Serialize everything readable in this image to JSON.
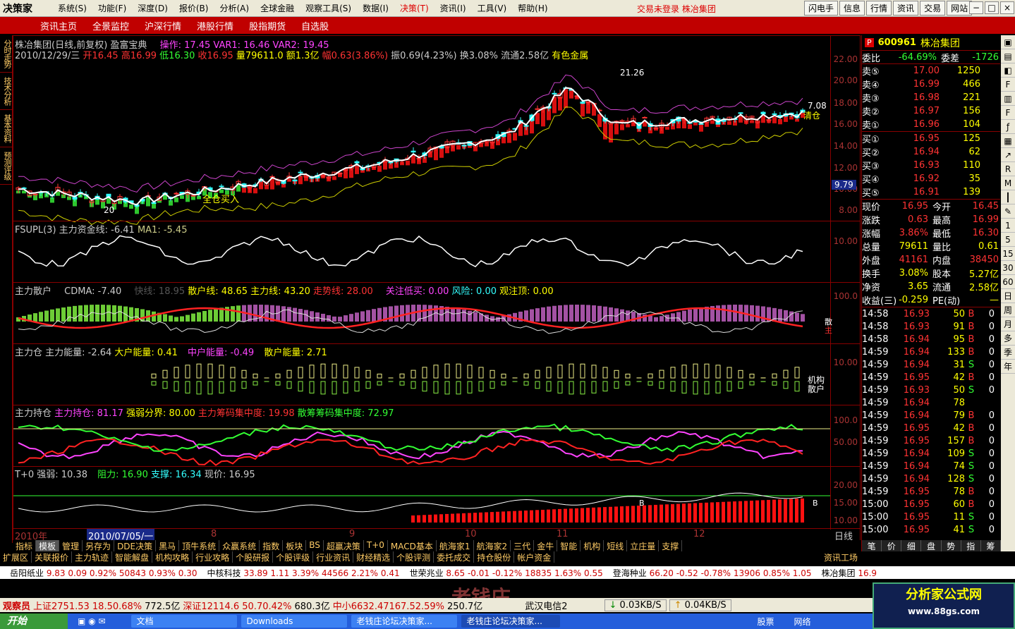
{
  "menubar": {
    "logo": "决策家",
    "items": [
      "系统(S)",
      "功能(F)",
      "深度(D)",
      "报价(B)",
      "分析(A)",
      "全球金融",
      "观察工具(S)",
      "数据(I)",
      "决策(T)",
      "资讯(I)",
      "工具(V)",
      "帮助(H)"
    ],
    "active_item": "决策(T)",
    "status_text": "交易未登录  株冶集团",
    "quick_buttons": [
      "闪电手",
      "信息",
      "行情",
      "资讯",
      "交易",
      "网站"
    ],
    "window_controls": [
      "−",
      "□",
      "×"
    ]
  },
  "navbar": {
    "tabs": [
      "资讯主页",
      "全景监控",
      "沪深行情",
      "港股行情",
      "股指期货",
      "自选股"
    ]
  },
  "leftstrip": [
    "分时走势",
    "技术分析",
    "基本资料",
    "预测评级"
  ],
  "chart": {
    "header1": "株冶集团(日线,前复权) 盈富宝典",
    "header1_ops": "操作: 17.45 VAR1: 16.46 VAR2: 19.45",
    "header2_date": "2010/12/29/三",
    "header2_open": "开16.45",
    "header2_high": "高16.99",
    "header2_low": "低16.30",
    "header2_close": "收16.95",
    "header2_vol": "量79611.0",
    "header2_amt": "额1.3亿",
    "header2_range": "幅0.63(3.86%)",
    "header2_amp": "振0.69(4.23%)",
    "header2_turn": "换3.08%",
    "header2_float": "流通2.58亿",
    "header2_industry": "有色金属",
    "main_yticks": [
      "22.00",
      "20.00",
      "18.00",
      "16.00",
      "14.00",
      "12.00",
      "10.00",
      "8.00"
    ],
    "main_labels": {
      "high_mark": "21.26",
      "low_mark": "20",
      "buy_label": "全仓买入",
      "close_tag": "9.79",
      "right_label": "7.08",
      "pos_label": "清仓"
    },
    "panel2_title": "FSUPL(3) 主力资金线: -6.41",
    "panel2_ma": "MA1: -5.45",
    "panel2_ytick": "10.00",
    "panel3_title": "主力散户",
    "panel3_cdma": "CDMA: -7.40",
    "panel3_fast": "快线: 18.95",
    "panel3_retail": "散户线: 48.65",
    "panel3_main": "主力线: 43.20",
    "panel3_trend": "走势线: 28.00",
    "panel3_watch": "关注低买: 0.00",
    "panel3_risk": "风险: 0.00",
    "panel3_top": "观注顶: 0.00",
    "panel3_ytick": "100.0",
    "panel3_right_labels": [
      "散",
      "主"
    ],
    "panel4_title": "主力仓 主力能量: -2.64",
    "panel4_big": "大户能量: 0.41",
    "panel4_mid": "中户能量: -0.49",
    "panel4_retail": "散户能量: 2.71",
    "panel4_ytick": "10.00",
    "panel4_right_labels": [
      "机构",
      "散户"
    ],
    "panel5_title": "主力持仓",
    "panel5_hold": "主力持仓: 81.17",
    "panel5_bound": "强弱分界: 80.00",
    "panel5_conc": "主力筹码集中度: 19.98",
    "panel5_retail": "散筹筹码集中度: 72.97",
    "panel5_yticks": [
      "100.0",
      "50.00"
    ],
    "panel6_title": "T+0 强弱: 10.38",
    "panel6_res": "阻力: 16.90",
    "panel6_sup": "支撑: 16.34",
    "panel6_price": "现价: 16.95",
    "panel6_yticks": [
      "20.00",
      "15.00",
      "10.00"
    ],
    "panel6_marks": [
      "B",
      "B",
      "B"
    ],
    "xaxis": {
      "year": "2010年",
      "cursor": "2010/07/05/一",
      "months": [
        "8",
        "9",
        "10",
        "11",
        "12"
      ],
      "period": "日线"
    }
  },
  "quote": {
    "code": "600961",
    "name": "株冶集团",
    "weibi_label": "委比",
    "weibi": "-64.69%",
    "weicha_label": "委差",
    "weicha": "-1726",
    "asks": [
      {
        "label": "卖⑤",
        "price": "17.00",
        "vol": "1250"
      },
      {
        "label": "卖④",
        "price": "16.99",
        "vol": "466"
      },
      {
        "label": "卖③",
        "price": "16.98",
        "vol": "221"
      },
      {
        "label": "卖②",
        "price": "16.97",
        "vol": "156"
      },
      {
        "label": "卖①",
        "price": "16.96",
        "vol": "104"
      }
    ],
    "bids": [
      {
        "label": "买①",
        "price": "16.95",
        "vol": "125"
      },
      {
        "label": "买②",
        "price": "16.94",
        "vol": "62"
      },
      {
        "label": "买③",
        "price": "16.93",
        "vol": "110"
      },
      {
        "label": "买④",
        "price": "16.92",
        "vol": "35"
      },
      {
        "label": "买⑤",
        "price": "16.91",
        "vol": "139"
      }
    ],
    "stats": [
      [
        "现价",
        "16.95",
        "今开",
        "16.45"
      ],
      [
        "涨跌",
        "0.63",
        "最高",
        "16.99"
      ],
      [
        "涨幅",
        "3.86%",
        "最低",
        "16.30"
      ],
      [
        "总量",
        "79611",
        "量比",
        "0.61"
      ],
      [
        "外盘",
        "41161",
        "内盘",
        "38450"
      ],
      [
        "换手",
        "3.08%",
        "股本",
        "5.27亿"
      ],
      [
        "净资",
        "3.65",
        "流通",
        "2.58亿"
      ],
      [
        "收益(三)",
        "-0.259",
        "PE(动)",
        "—"
      ]
    ],
    "ticks": [
      [
        "14:58",
        "16.93",
        "50",
        "B",
        "0"
      ],
      [
        "14:58",
        "16.93",
        "91",
        "B",
        "0"
      ],
      [
        "14:58",
        "16.94",
        "95",
        "B",
        "0"
      ],
      [
        "14:59",
        "16.94",
        "133",
        "B",
        "0"
      ],
      [
        "14:59",
        "16.94",
        "31",
        "S",
        "0"
      ],
      [
        "14:59",
        "16.95",
        "42",
        "B",
        "0"
      ],
      [
        "14:59",
        "16.93",
        "50",
        "S",
        "0"
      ],
      [
        "14:59",
        "16.94",
        "78",
        "",
        ""
      ],
      [
        "14:59",
        "16.94",
        "79",
        "B",
        "0"
      ],
      [
        "14:59",
        "16.95",
        "42",
        "B",
        "0"
      ],
      [
        "14:59",
        "16.95",
        "157",
        "B",
        "0"
      ],
      [
        "14:59",
        "16.94",
        "109",
        "S",
        "0"
      ],
      [
        "14:59",
        "16.94",
        "74",
        "S",
        "0"
      ],
      [
        "14:59",
        "16.94",
        "128",
        "S",
        "0"
      ],
      [
        "14:59",
        "16.95",
        "78",
        "B",
        "0"
      ],
      [
        "15:00",
        "16.95",
        "60",
        "B",
        "0"
      ],
      [
        "15:00",
        "16.95",
        "11",
        "S",
        "0"
      ],
      [
        "15:00",
        "16.95",
        "41",
        "S",
        "0"
      ]
    ],
    "tabs": [
      "笔",
      "价",
      "细",
      "盘",
      "势",
      "指",
      "筹"
    ]
  },
  "farright": [
    "1",
    "5",
    "15",
    "30",
    "60",
    "日",
    "周",
    "月",
    "多",
    "季",
    "年"
  ],
  "tabbar1": [
    "指标",
    "模板",
    "管理",
    "另存为",
    "DDE决策",
    "黑马",
    "顶牛系统",
    "众赢系统",
    "指数",
    "板块",
    "BS",
    "超赢决策",
    "T+0",
    "MACD基本",
    "航海家1",
    "航海家2",
    "三代",
    "金牛",
    "智能",
    "机构",
    "短线",
    "立庄量",
    "支撑"
  ],
  "tabbar1_selected": "模板",
  "tabbar2": [
    "扩展区",
    "关联报价",
    "主力轨迹",
    "智能解盘",
    "机构攻略",
    "行业攻略",
    "个股研报",
    "个股评级",
    "行业资讯",
    "财经精选",
    "个股评测",
    "委托成交",
    "持仓股份",
    "帐户资金"
  ],
  "tabbar2_right": "资讯工场",
  "ticker": [
    {
      "name": "岳阳纸业",
      "vals": "9.83  0.09  0.92%  50843  0.93%  0.30"
    },
    {
      "name": "中核科技",
      "vals": "33.89  1.11  3.39%  44566  2.21%  0.41"
    },
    {
      "name": "世荣兆业",
      "vals": "8.65  -0.01  -0.12%  18835  1.63%  0.55"
    },
    {
      "name": "登海种业",
      "vals": "66.20  -0.52  -0.78%  13906  0.85%  1.05"
    },
    {
      "name": "株冶集团",
      "vals": "16.9"
    }
  ],
  "indexbar": {
    "observer": "观察员",
    "sh": "上证2751.53  18.50.68%",
    "sh_vol": "772.5亿",
    "sz": "深证12114.6  50.70.42%",
    "sz_vol": "680.3亿",
    "zxb": "中小6632.47167.52.59%",
    "zxb_vol": "250.7亿",
    "stock": "武汉电信2",
    "down": "0.03KB/S",
    "up": "0.04KB/S"
  },
  "taskbar": {
    "start": "开始",
    "items": [
      "文档",
      "Downloads",
      "老钱庄论坛决策家...",
      "老钱庄论坛决策家..."
    ],
    "right": [
      "股票",
      "网络"
    ]
  },
  "watermark": {
    "title": "分析家公式网",
    "url": "www.88gs.com"
  },
  "logo2": "老钱庄",
  "colors": {
    "up": "#ff3333",
    "down": "#33ffff",
    "yellow": "#ffff00",
    "magenta": "#ff44ff",
    "green": "#33ff33",
    "frame": "#880000"
  }
}
